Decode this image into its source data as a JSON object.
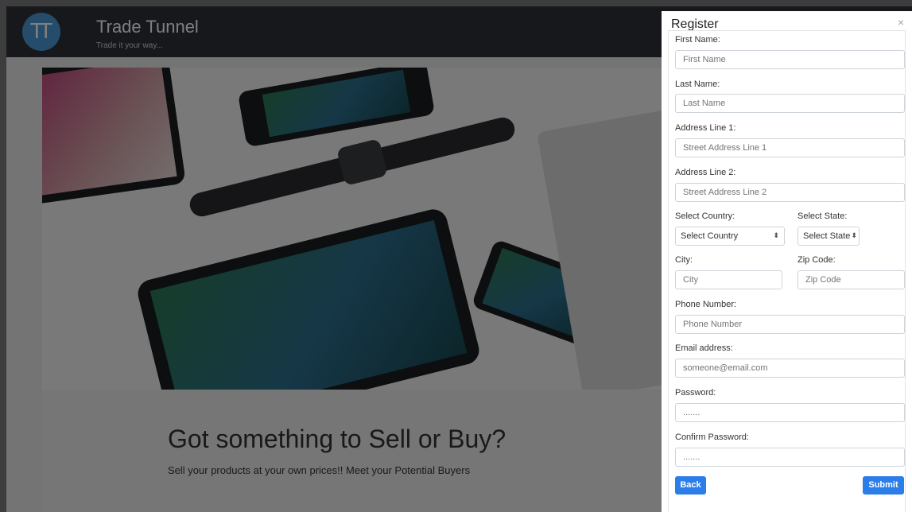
{
  "navbar": {
    "logo_text": "TT",
    "brand": "Trade Tunnel",
    "tagline": "Trade it your way..."
  },
  "hero": {
    "title": "Got something to Sell or Buy?",
    "subtitle": "Sell your products at your own prices!! Meet your Potential Buyers"
  },
  "modal": {
    "title": "Register",
    "close": "×",
    "fields": {
      "first_name": {
        "label": "First Name:",
        "placeholder": "First Name"
      },
      "last_name": {
        "label": "Last Name:",
        "placeholder": "Last Name"
      },
      "address1": {
        "label": "Address Line 1:",
        "placeholder": "Street Address Line 1"
      },
      "address2": {
        "label": "Address Line 2:",
        "placeholder": "Street Address Line 2"
      },
      "country": {
        "label": "Select Country:",
        "value": "Select Country"
      },
      "state": {
        "label": "Select State:",
        "value": "Select State"
      },
      "city": {
        "label": "City:",
        "placeholder": "City"
      },
      "zip": {
        "label": "Zip Code:",
        "placeholder": "Zip Code"
      },
      "phone": {
        "label": "Phone Number:",
        "placeholder": "Phone Number"
      },
      "email": {
        "label": "Email address:",
        "placeholder": "someone@email.com"
      },
      "password": {
        "label": "Password:",
        "placeholder": "......."
      },
      "confirm": {
        "label": "Confirm Password:",
        "placeholder": "......."
      }
    },
    "back_label": "Back",
    "submit_label": "Submit"
  },
  "icons": {
    "select_caret": "updown-caret-icon"
  },
  "colors": {
    "accent": "#2b7de9",
    "navbar": "#2e3136",
    "logo": "#4a9bd6"
  }
}
